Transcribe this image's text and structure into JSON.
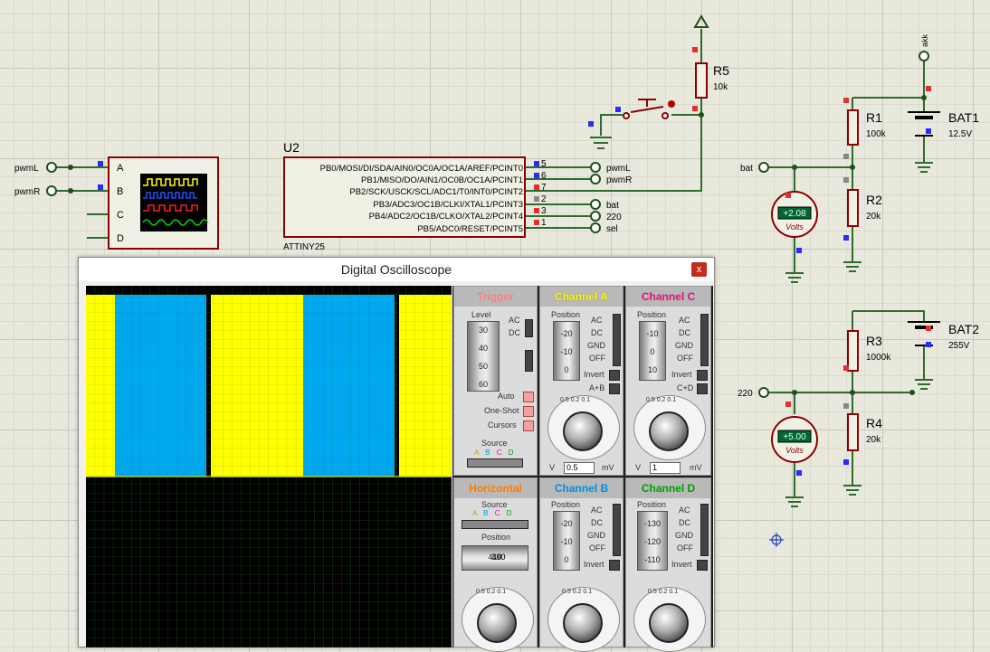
{
  "schematic": {
    "u2_label": "U2",
    "u2_part": "ATTINY25",
    "u2_pins_left": [
      "PB0/MOSI/DI/SDA/AIN0/OC0A/OC1A/AREF/PCINT0",
      "PB1/MISO/DO/AIN1/OC0B/OC1A/PCINT1",
      "PB2/SCK/USCK/SCL/ADC1/T0/INT0/PCINT2",
      "PB3/ADC3/OC1B/CLKI/XTAL1/PCINT3",
      "PB4/ADC2/OC1B/CLKO/XTAL2/PCINT4",
      "PB5/ADC0/RESET/PCINT5"
    ],
    "u2_pin_numbers": [
      "5",
      "6",
      "7",
      "2",
      "3",
      "1"
    ],
    "u2_net_labels": [
      "pwmL",
      "pwmR",
      "bat",
      "220",
      "sel"
    ],
    "scope_terminals": [
      "pwmL",
      "pwmR"
    ],
    "scope_channels": [
      "A",
      "B",
      "C",
      "D"
    ],
    "r5": {
      "name": "R5",
      "value": "10k"
    },
    "r1": {
      "name": "R1",
      "value": "100k"
    },
    "r2": {
      "name": "R2",
      "value": "20k"
    },
    "r3": {
      "name": "R3",
      "value": "1000k"
    },
    "r4": {
      "name": "R4",
      "value": "20k"
    },
    "bat1": {
      "name": "BAT1",
      "value": "12.5V"
    },
    "bat2": {
      "name": "BAT2",
      "value": "255V"
    },
    "akk": "akk",
    "bat_terminal": "bat",
    "t220": "220",
    "vm1": {
      "reading": "+2.08",
      "unit": "Volts"
    },
    "vm2": {
      "reading": "+5.00",
      "unit": "Volts"
    }
  },
  "oscilloscope": {
    "title": "Digital Oscilloscope",
    "close": "x",
    "trigger": {
      "title": "Trigger",
      "level_label": "Level",
      "level_ticks": [
        "30",
        "40",
        "50",
        "60"
      ],
      "coupling": [
        "AC",
        "DC"
      ],
      "modes": [
        "Auto",
        "One-Shot",
        "Cursors"
      ],
      "source_label": "Source",
      "sources": [
        "A",
        "B",
        "C",
        "D"
      ]
    },
    "channel_a": {
      "title": "Channel A",
      "position_label": "Position",
      "position_ticks": [
        "-20",
        "-10",
        "0"
      ],
      "coupling": [
        "AC",
        "DC",
        "GND",
        "OFF"
      ],
      "invert": "Invert",
      "combine": "A+B",
      "dial": [
        "0.5",
        "0.2",
        "0.1",
        "50",
        "20",
        "10",
        "5",
        "2",
        "1"
      ],
      "value": "0.5",
      "unit_left": "V",
      "unit_right": "mV"
    },
    "channel_c": {
      "title": "Channel C",
      "position_label": "Position",
      "position_ticks": [
        "-10",
        "0",
        "10"
      ],
      "coupling": [
        "AC",
        "DC",
        "GND",
        "OFF"
      ],
      "invert": "Invert",
      "combine": "C+D",
      "dial": [
        "0.5",
        "0.2",
        "0.1",
        "50",
        "20",
        "10",
        "5",
        "2",
        "1"
      ],
      "value": "1",
      "unit_left": "V",
      "unit_right": "mV"
    },
    "horizontal": {
      "title": "Horizontal",
      "source_label": "Source",
      "sources": [
        "A",
        "B",
        "C",
        "D"
      ],
      "position_label": "Position",
      "position_ticks": [
        "410",
        "400",
        "390"
      ],
      "dial": [
        "0.5",
        "0.2",
        "0.1",
        "50"
      ]
    },
    "channel_b": {
      "title": "Channel B",
      "position_label": "Position",
      "position_ticks": [
        "-20",
        "-10",
        "0"
      ],
      "coupling": [
        "AC",
        "DC",
        "GND",
        "OFF"
      ],
      "invert": "Invert",
      "dial": [
        "0.5",
        "0.2",
        "0.1",
        "50"
      ]
    },
    "channel_d": {
      "title": "Channel D",
      "position_label": "Position",
      "position_ticks": [
        "-130",
        "-120",
        "-110"
      ],
      "coupling": [
        "AC",
        "DC",
        "GND",
        "OFF"
      ],
      "invert": "Invert",
      "dial": [
        "0.5",
        "0.2",
        "0.1",
        "50"
      ]
    },
    "colors": {
      "ch_a": "#ffff00",
      "ch_b": "#00b0ff",
      "ch_c": "#ff20a0",
      "ch_d": "#00c000",
      "trigger": "#ff8080",
      "horizontal": "#ff7a00"
    }
  }
}
